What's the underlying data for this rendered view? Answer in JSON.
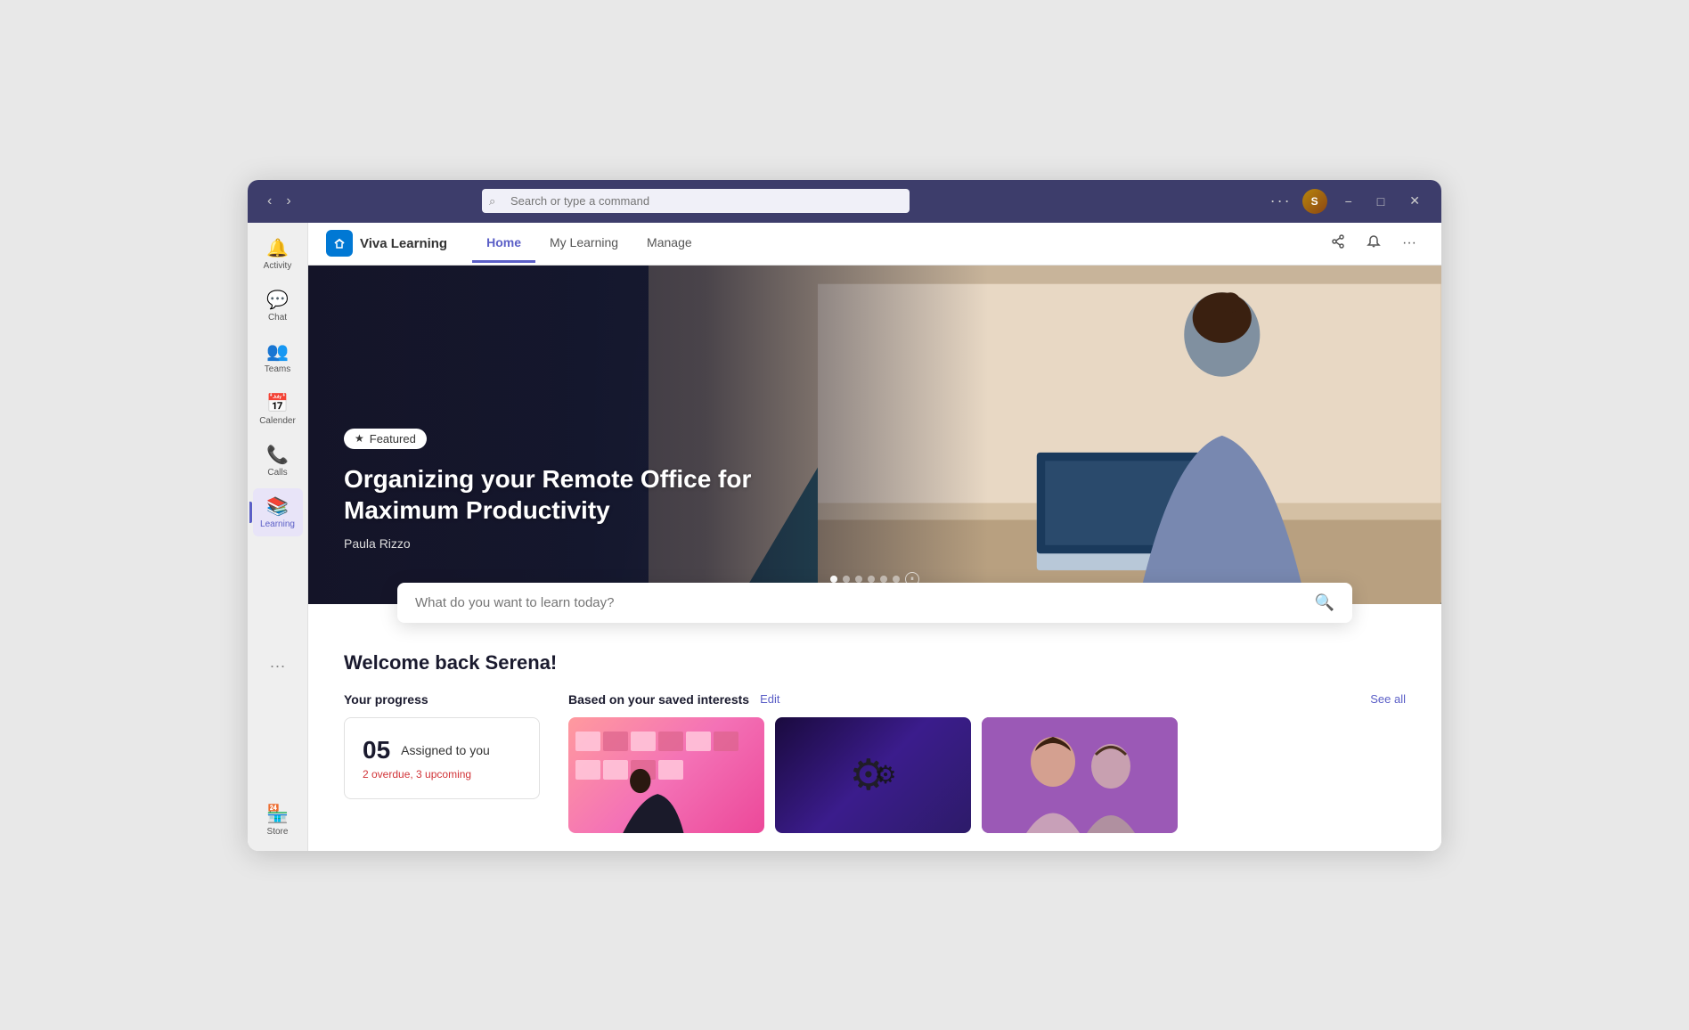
{
  "titlebar": {
    "search_placeholder": "Search or type a command",
    "dots_label": "···",
    "minimize_label": "−",
    "maximize_label": "□",
    "close_label": "✕"
  },
  "sidebar": {
    "items": [
      {
        "id": "activity",
        "label": "Activity",
        "icon": "🔔"
      },
      {
        "id": "chat",
        "label": "Chat",
        "icon": "💬"
      },
      {
        "id": "teams",
        "label": "Teams",
        "icon": "👥"
      },
      {
        "id": "calendar",
        "label": "Calender",
        "icon": "📅"
      },
      {
        "id": "calls",
        "label": "Calls",
        "icon": "📞"
      },
      {
        "id": "learning",
        "label": "Learning",
        "icon": "📚",
        "active": true
      }
    ],
    "dots_label": "···",
    "store_label": "Store",
    "store_icon": "🏪"
  },
  "app_header": {
    "app_name": "Viva Learning",
    "nav_items": [
      {
        "label": "Home",
        "active": true
      },
      {
        "label": "My Learning",
        "active": false
      },
      {
        "label": "Manage",
        "active": false
      }
    ]
  },
  "hero": {
    "badge_label": "Featured",
    "title": "Organizing your Remote Office for Maximum Productivity",
    "author": "Paula Rizzo",
    "dots_count": 6,
    "active_dot": 0
  },
  "search": {
    "placeholder": "What do you want to learn today?"
  },
  "welcome": {
    "title": "Welcome back Serena!",
    "progress_section_label": "Your progress",
    "assigned_count": "05",
    "assigned_label": "Assigned to you",
    "assigned_sub": "2 overdue, 3 upcoming",
    "interests_label": "Based on your saved interests",
    "edit_label": "Edit",
    "see_all_label": "See all",
    "course_cards": [
      {
        "id": "card1",
        "type": "pink"
      },
      {
        "id": "card2",
        "type": "dark"
      },
      {
        "id": "card3",
        "type": "light"
      }
    ]
  }
}
